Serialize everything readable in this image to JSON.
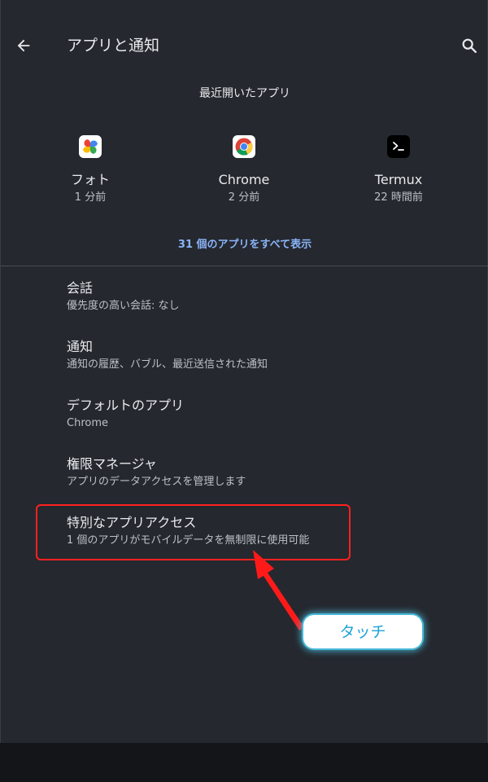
{
  "app_bar": {
    "title": "アプリと通知",
    "back_icon": "arrow-back-icon",
    "search_icon": "search-icon"
  },
  "recent": {
    "title": "最近開いたアプリ",
    "apps": [
      {
        "name": "フォト",
        "time": "1 分前",
        "icon": "google-photos-icon"
      },
      {
        "name": "Chrome",
        "time": "2 分前",
        "icon": "chrome-icon"
      },
      {
        "name": "Termux",
        "time": "22 時間前",
        "icon": "termux-icon"
      }
    ],
    "show_all": "31 個のアプリをすべて表示"
  },
  "settings": [
    {
      "title": "会話",
      "summary": "優先度の高い会話: なし"
    },
    {
      "title": "通知",
      "summary": "通知の履歴、バブル、最近送信された通知"
    },
    {
      "title": "デフォルトのアプリ",
      "summary": "Chrome"
    },
    {
      "title": "権限マネージャ",
      "summary": "アプリのデータアクセスを管理します"
    },
    {
      "title": "特別なアプリアクセス",
      "summary": "1 個のアプリがモバイルデータを無制限に使用可能"
    }
  ],
  "annotation": {
    "callout_text": "タッチ",
    "highlight_color": "#ff2020",
    "callout_border_color": "#49b8d8"
  },
  "colors": {
    "background": "#25282e",
    "accent": "#8ab4f8",
    "text_primary": "#e8eaed",
    "text_secondary": "#bdc1c6"
  }
}
